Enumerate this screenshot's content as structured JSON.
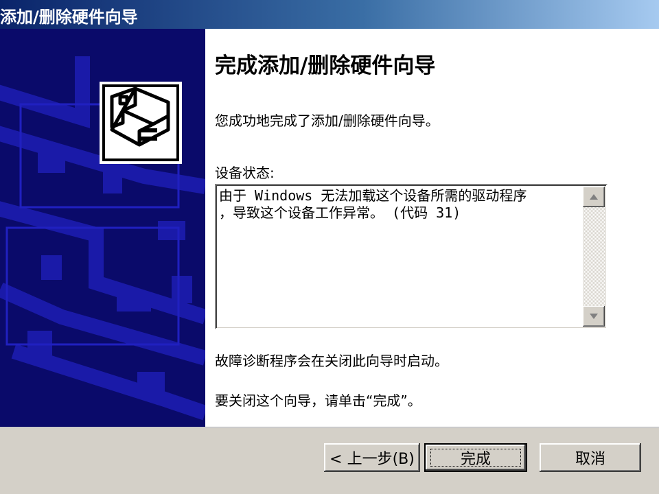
{
  "window": {
    "title": "添加/删除硬件向导"
  },
  "content": {
    "heading": "完成添加/删除硬件向导",
    "completed_text": "您成功地完成了添加/删除硬件向导。",
    "status_label": "设备状态:",
    "status_lines": [
      "由于 Windows 无法加载这个设备所需的驱动程序",
      "，导致这个设备工作异常。 (代码 31)"
    ],
    "troubleshoot_text": "故障诊断程序会在关闭此向导时启动。",
    "close_text": "要关闭这个向导，请单击“完成”。"
  },
  "buttons": {
    "back": "< 上一步(B)",
    "finish": "完成",
    "cancel": "取消"
  },
  "colors": {
    "titlebar_start": "#0a246a",
    "titlebar_end": "#a6caf0",
    "sidebar_bg": "#0a0a6a",
    "sidebar_art": "#1a1aa8"
  },
  "icons": {
    "wizard_icon": "hardware-card-drive-icon",
    "scroll_up": "triangle-up-icon",
    "scroll_down": "triangle-down-icon"
  }
}
